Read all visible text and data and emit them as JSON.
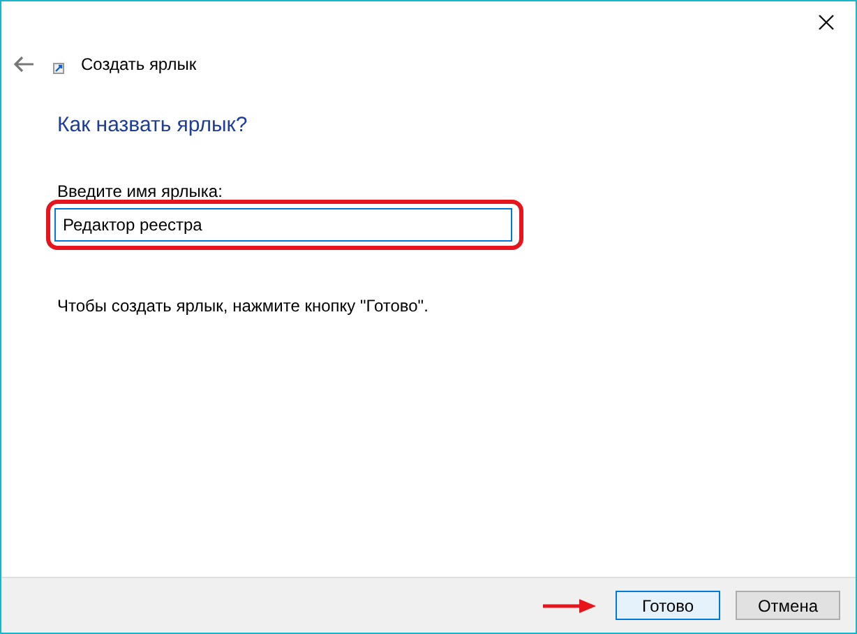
{
  "window": {
    "title": "Создать ярлык"
  },
  "heading": "Как назвать ярлык?",
  "name_field": {
    "label": "Введите имя ярлыка:",
    "value": "Редактор реестра"
  },
  "instruction": "Чтобы создать ярлык, нажмите кнопку \"Готово\".",
  "buttons": [
    {
      "label": "Готово",
      "kind": "default"
    },
    {
      "label": "Отмена",
      "kind": "normal"
    }
  ]
}
